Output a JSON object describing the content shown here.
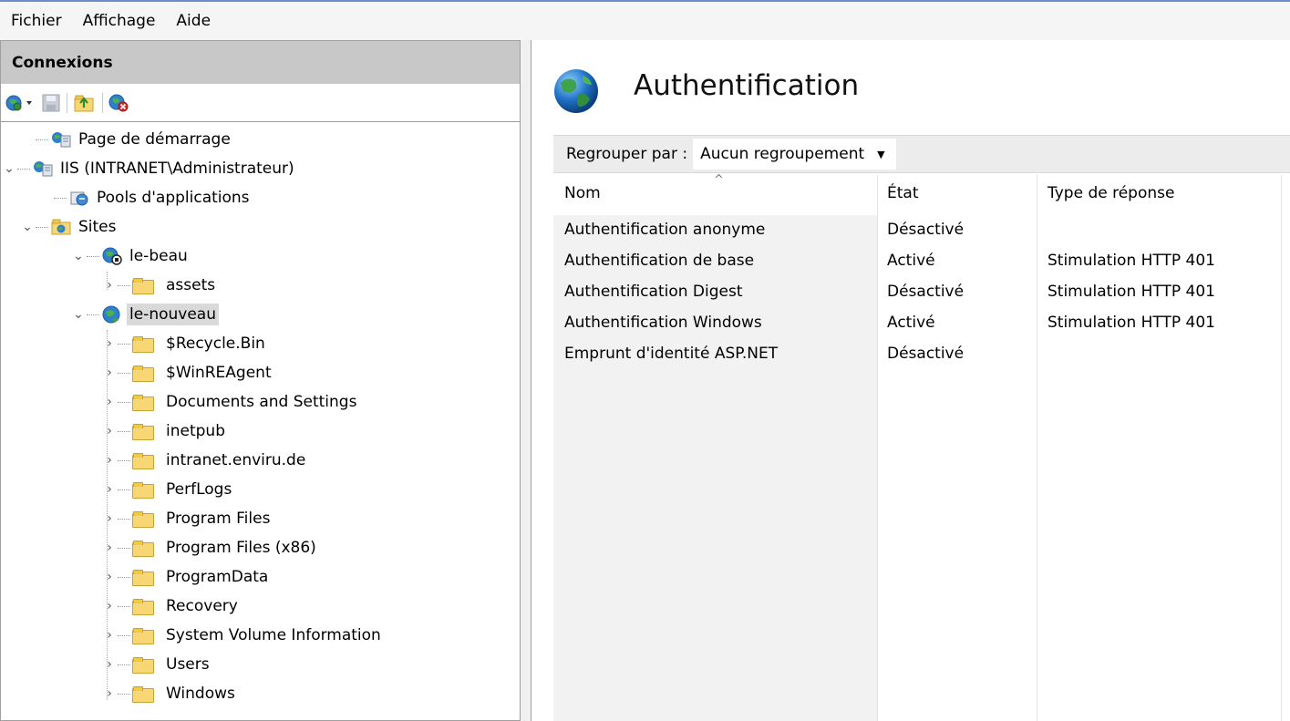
{
  "menu": [
    "Fichier",
    "Affichage",
    "Aide"
  ],
  "connections": {
    "title": "Connexions",
    "toolbar_icons": [
      "connect-icon",
      "save-icon",
      "up-folder-icon",
      "disconnect-icon"
    ],
    "tree": {
      "start_page": "Page de démarrage",
      "server": "IIS (INTRANET\\Administrateur)",
      "app_pools": "Pools d'applications",
      "sites": "Sites",
      "site1": "le-beau",
      "site1_child": "assets",
      "site2": "le-nouveau",
      "folders": [
        "$Recycle.Bin",
        "$WinREAgent",
        "Documents and Settings",
        "inetpub",
        "intranet.enviru.de",
        "PerfLogs",
        "Program Files",
        "Program Files (x86)",
        "ProgramData",
        "Recovery",
        "System Volume Information",
        "Users",
        "Windows"
      ]
    }
  },
  "feature": {
    "title": "Authentification",
    "group_label": "Regrouper par :",
    "group_value": "Aucun regroupement",
    "columns": [
      "Nom",
      "État",
      "Type de réponse"
    ],
    "rows": [
      {
        "name": "Authentification anonyme",
        "state": "Désactivé",
        "response": ""
      },
      {
        "name": "Authentification de base",
        "state": "Activé",
        "response": "Stimulation HTTP 401"
      },
      {
        "name": "Authentification Digest",
        "state": "Désactivé",
        "response": "Stimulation HTTP 401"
      },
      {
        "name": "Authentification Windows",
        "state": "Activé",
        "response": "Stimulation HTTP 401"
      },
      {
        "name": "Emprunt d'identité ASP.NET",
        "state": "Désactivé",
        "response": ""
      }
    ]
  }
}
